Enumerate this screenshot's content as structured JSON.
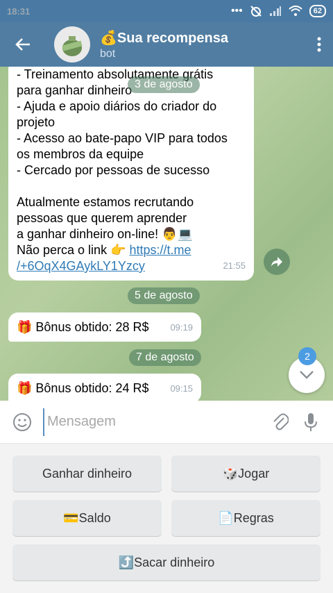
{
  "status_bar": {
    "time": "18:31",
    "battery": "62"
  },
  "header": {
    "title": "💰Sua recompensa",
    "subtitle": "bot"
  },
  "messages": {
    "promo_lines": [
      "- Treinamento absolutamente grátis",
      "para ganhar dinheiro",
      "- Ajuda e apoio diários do criador do",
      "projeto",
      "- Acesso ao bate-papo VIP para todos",
      "os membros da equipe",
      "- Cercado por pessoas de sucesso",
      "",
      "Atualmente estamos recrutando",
      "pessoas que querem aprender",
      "a ganhar dinheiro on-line! 👨💻"
    ],
    "promo_link_prefix": "Não perca o link 👉 ",
    "promo_link_1": "https://t.me",
    "promo_link_2": "/+6OqX4GAykLY1Yzcy",
    "promo_time": "21:55",
    "floating_date": "3 de agosto",
    "date_1": "5 de agosto",
    "bonus_1": "🎁 Bônus obtido: 28 R$",
    "bonus_1_time": "09:19",
    "date_2": "7 de agosto",
    "bonus_2": "🎁 Bônus obtido: 24 R$",
    "bonus_2_time": "09:15",
    "unread_count": "2"
  },
  "input": {
    "placeholder": "Mensagem"
  },
  "keyboard": {
    "earn": "Ganhar dinheiro",
    "play": "🎲Jogar",
    "balance": "💳Saldo",
    "rules": "📄Regras",
    "withdraw": "⤴️Sacar dinheiro"
  },
  "colors": {
    "header": "#517da2",
    "status_bar": "#4a7aa3",
    "link": "#2f7bb7",
    "badge": "#4c9ce2"
  }
}
